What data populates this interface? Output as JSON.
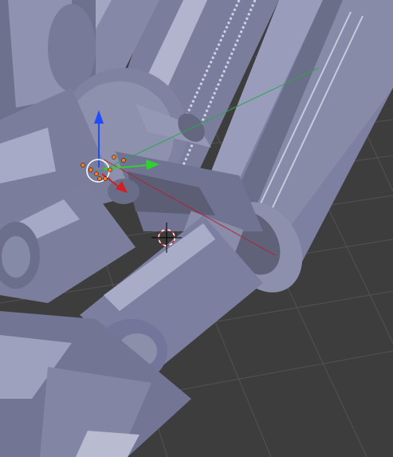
{
  "viewport": {
    "background": "#3d3d3d",
    "grid_color": "#5a5a5a",
    "mesh_base": "#7e80a0",
    "mesh_light": "#a7aac6",
    "mesh_dark": "#55586e"
  },
  "axes": {
    "x_color": "#c8202a",
    "y_color": "#2fd02f",
    "z_color": "#1e4dff"
  },
  "gizmo": {
    "x_icon": "arrow-right-red-icon",
    "y_icon": "arrow-green-icon",
    "z_icon": "arrow-up-blue-icon"
  },
  "cursor": {
    "icon": "3d-cursor-icon"
  }
}
